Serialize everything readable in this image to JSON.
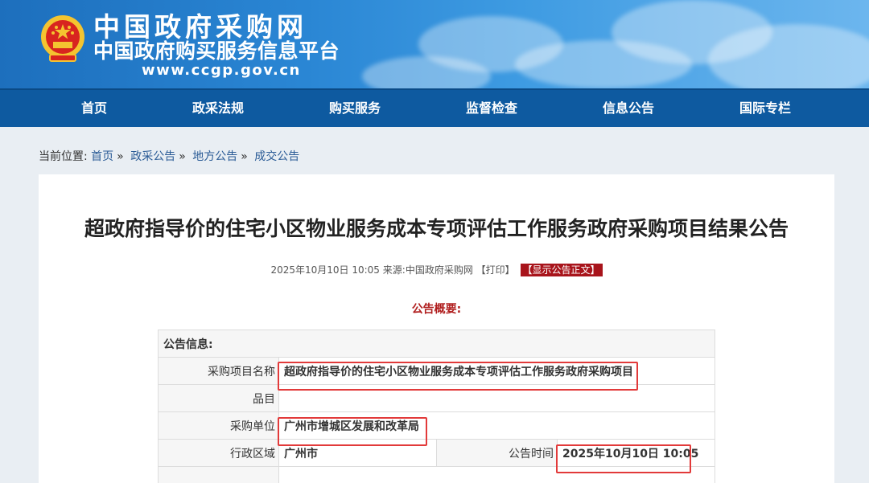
{
  "header": {
    "title": "中国政府采购网",
    "subtitle": "中国政府购买服务信息平台",
    "url": "www.ccgp.gov.cn"
  },
  "nav": {
    "items": [
      {
        "label": "首页"
      },
      {
        "label": "政采法规"
      },
      {
        "label": "购买服务"
      },
      {
        "label": "监督检查"
      },
      {
        "label": "信息公告"
      },
      {
        "label": "国际专栏"
      }
    ]
  },
  "breadcrumb": {
    "prefix": "当前位置:",
    "items": [
      {
        "label": "首页"
      },
      {
        "label": "政采公告"
      },
      {
        "label": "地方公告"
      },
      {
        "label": "成交公告"
      }
    ],
    "separator": "»"
  },
  "document": {
    "title": "超政府指导价的住宅小区物业服务成本专项评估工作服务政府采购项目结果公告",
    "meta": "2025年10月10日 10:05 来源:",
    "source_link": "中国政府采购网",
    "print_label": "【打印】",
    "show_label": "【显示公告正文】",
    "summary_label": "公告概要:"
  },
  "table": {
    "header": "公告信息:",
    "rows": [
      {
        "label": "采购项目名称",
        "value": "超政府指导价的住宅小区物业服务成本专项评估工作服务政府采购项目"
      },
      {
        "label": "品目",
        "value": ""
      },
      {
        "label": "采购单位",
        "value": "广州市增城区发展和改革局"
      },
      {
        "label": "行政区域",
        "value": "广州市",
        "label2": "公告时间",
        "value2": "2025年10月10日 10:05"
      }
    ]
  },
  "colors": {
    "nav_bg": "#0e5aa0",
    "highlight": "#e23a3a",
    "accent_red": "#a8141b"
  }
}
